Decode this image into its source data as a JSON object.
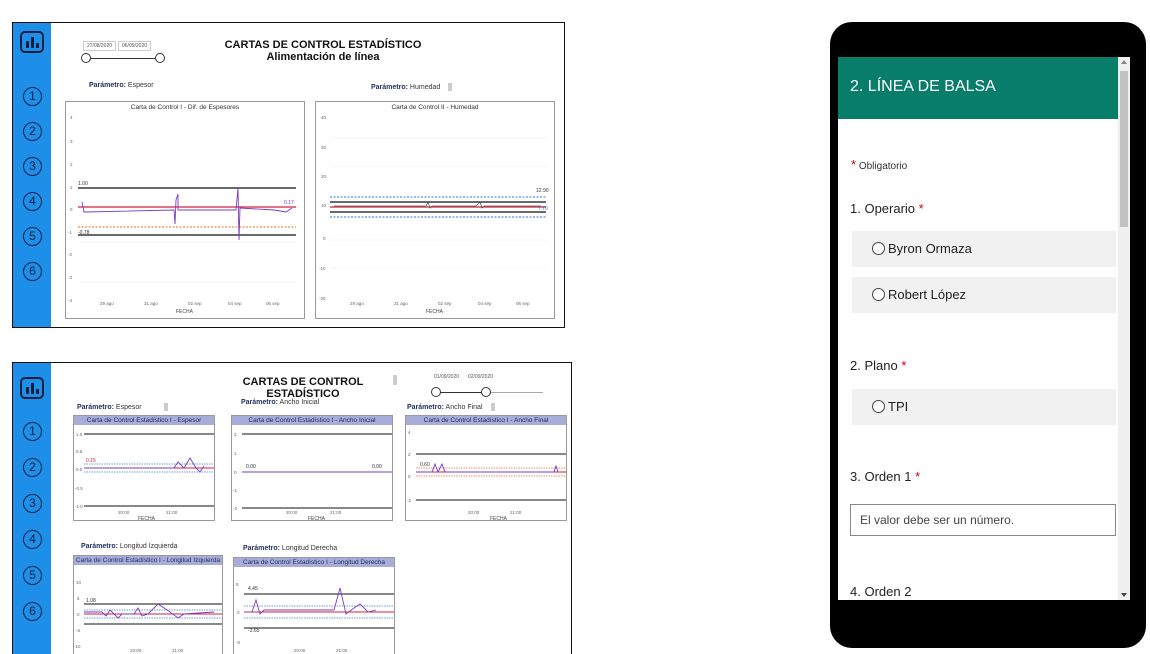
{
  "dashboard1": {
    "title": "CARTAS DE CONTROL ESTADÍSTICO",
    "subtitle": "Alimentación de línea",
    "date_from": "27/08/2020",
    "date_to": "06/09/2020",
    "rail_numbers": [
      "1",
      "2",
      "3",
      "4",
      "5",
      "6"
    ],
    "param_label": "Parámetro:",
    "param1": "Espesor",
    "param2": "Humedad",
    "chart1_title": "Carta de Control I - Dif. de Espesores",
    "chart2_title": "Carta de Control II - Humedad",
    "xlabel": "FECHA",
    "chart1_yticks": [
      "4",
      "3",
      "2",
      "1",
      "0",
      "-1",
      "-2",
      "-3",
      "-4"
    ],
    "chart2_yticks": [
      "40",
      "20",
      "0",
      "-20"
    ],
    "chart2_yticks_mid": [
      "30",
      "10",
      "-10"
    ],
    "xticks": [
      "29 ago",
      "31 ago",
      "02 sep",
      "04 sep",
      "06 sep"
    ],
    "chart1_ucl": "1.00",
    "chart1_lcl": "-0.78",
    "chart1_cl": "0.17",
    "chart2_ucl": "12.90",
    "chart2_lcl": "7.70"
  },
  "dashboard2": {
    "title": "CARTAS DE CONTROL ESTADÍSTICO",
    "date_from": "01/09/2020",
    "date_to": "02/09/2020",
    "rail_numbers": [
      "1",
      "2",
      "3",
      "4",
      "5",
      "6"
    ],
    "param_label": "Parámetro:",
    "p1": "Espesor",
    "p2": "Ancho Inicial",
    "p3": "Ancho Final",
    "p4": "Longitud Izquierda",
    "p5": "Longitud Derecha",
    "c1": "Carta de Control Estadístico I - Espesor",
    "c2": "Carta de Control Estadístico I - Ancho Inicial",
    "c3": "Carta de Control Estadístico I - Ancho Final",
    "c4": "Carta de Control Estadístico I - Longitud Izquierda",
    "c5": "Carta de Control Estadístico I - Longitud Derecha",
    "xlabel": "FECHA",
    "xt1": "20:00",
    "xt2": "21:00",
    "c1_yticks": [
      "1.0",
      "0.5",
      "0.0",
      "-0.5",
      "-1.0"
    ],
    "c1_val": "0.15",
    "c2_yticks": [
      "2",
      "1",
      "0",
      "-1",
      "-2"
    ],
    "c2_val": "0.00",
    "c3_yticks": [
      "4",
      "2",
      "0",
      "-2"
    ],
    "c3_val": "0.60",
    "c4_yticks": [
      "10",
      "5",
      "0",
      "-5",
      "-10"
    ],
    "c4_val": "1.08",
    "c5_yticks": [
      "5",
      "0",
      "-5"
    ],
    "c5_val_top": "4.45",
    "c5_val_bot": "-3.65"
  },
  "form": {
    "header": "2. LÍNEA DE BALSA",
    "required_note": "Obligatorio",
    "q1": "1. Operario",
    "q1_opts": [
      "Byron Ormaza",
      "Robert López"
    ],
    "q2": "2. Plano",
    "q2_opts": [
      "TPI"
    ],
    "q3": "3. Orden 1",
    "q3_placeholder": "El valor debe ser un número.",
    "q4": "4. Orden 2",
    "star": "*"
  },
  "colors": {
    "rail": "#1e8fe8",
    "form_header": "#077d6a",
    "series": "#7a3cc2",
    "mean": "#d0213d",
    "limit_blue": "#2a73d9"
  }
}
